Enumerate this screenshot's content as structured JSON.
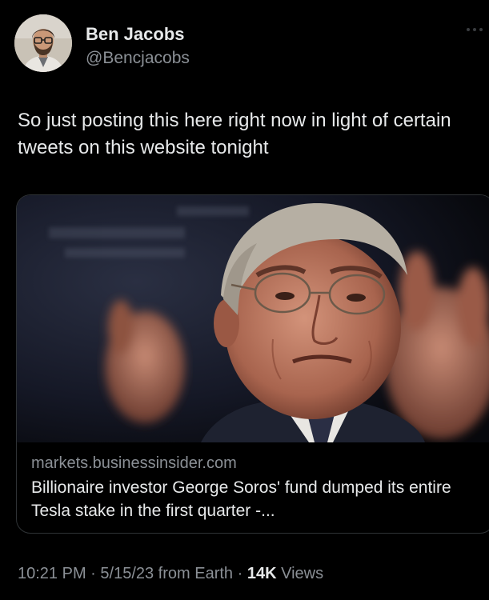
{
  "author": {
    "display_name": "Ben Jacobs",
    "handle": "@Bencjacobs",
    "avatar_icon": "avatar-photo"
  },
  "more_icon": "more-dots-icon",
  "tweet": {
    "text": "So just posting this here right now in light of certain tweets on this website tonight"
  },
  "card": {
    "domain": "markets.businessinsider.com",
    "title": "Billionaire investor George Soros' fund dumped its entire Tesla stake in the first quarter -..."
  },
  "footer": {
    "time": "10:21 PM",
    "sep1": " · ",
    "date": "5/15/23",
    "source": " from Earth",
    "sep2": " · ",
    "views_count": "14K",
    "views_label": " Views"
  },
  "colors": {
    "background": "#000000",
    "text": "#e7e9ea",
    "secondary": "#8b9096",
    "border": "#2f3336"
  }
}
